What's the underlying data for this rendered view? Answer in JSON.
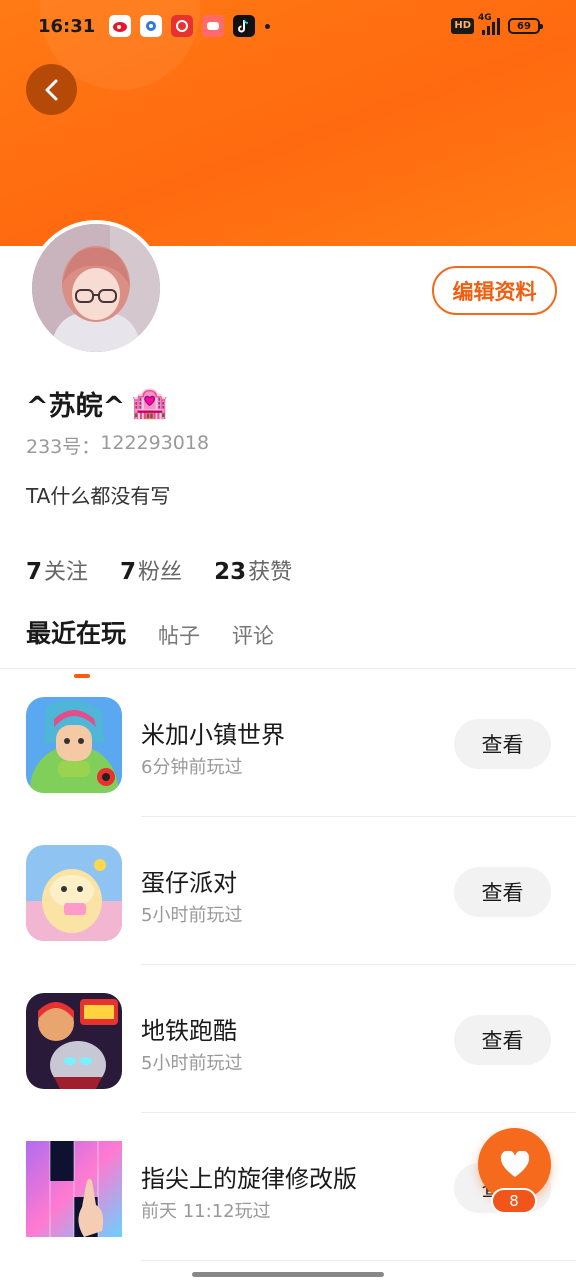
{
  "status_bar": {
    "time": "16:31",
    "network": "4G",
    "hd_label": "HD",
    "battery": "69",
    "notification_icons": [
      "weibo-icon",
      "browser-icon",
      "pinduoduo-icon",
      "game-center-icon",
      "tiktok-icon"
    ]
  },
  "header": {
    "back_icon": "chevron-left-icon",
    "accent_color": "#ff6a10"
  },
  "profile": {
    "nickname": "^苏皖^",
    "nickname_emoji": "🏩",
    "id_label": "233号：",
    "id_value": "122293018",
    "bio": "TA什么都没有写",
    "edit_button": "编辑资料"
  },
  "stats": [
    {
      "value": "7",
      "label": "关注"
    },
    {
      "value": "7",
      "label": "粉丝"
    },
    {
      "value": "23",
      "label": "获赞"
    }
  ],
  "tabs": [
    {
      "label": "最近在玩",
      "active": true
    },
    {
      "label": "帖子",
      "active": false
    },
    {
      "label": "评论",
      "active": false
    }
  ],
  "games": [
    {
      "name": "米加小镇世界",
      "time": "6分钟前玩过",
      "button": "查看",
      "icon": "miga-town-icon"
    },
    {
      "name": "蛋仔派对",
      "time": "5小时前玩过",
      "button": "查看",
      "icon": "eggy-party-icon"
    },
    {
      "name": "地铁跑酷",
      "time": "5小时前玩过",
      "button": "查看",
      "icon": "subway-surfers-icon"
    },
    {
      "name": "指尖上的旋律修改版",
      "time": "前天 11:12玩过",
      "button": "查看",
      "icon": "piano-tiles-icon"
    }
  ],
  "floating": {
    "icon": "heart-icon",
    "count": "8"
  }
}
